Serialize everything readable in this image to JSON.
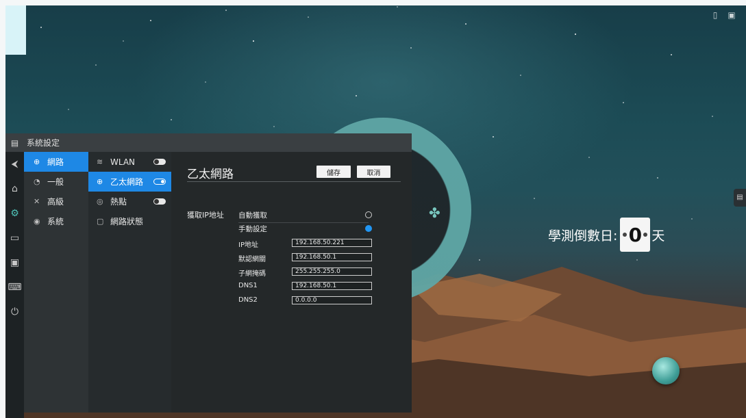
{
  "window": {
    "title": "系統設定"
  },
  "categories": [
    {
      "label": "網路",
      "icon": "globe-icon",
      "active": true
    },
    {
      "label": "一般",
      "icon": "palette-icon",
      "active": false
    },
    {
      "label": "高級",
      "icon": "tools-icon",
      "active": false
    },
    {
      "label": "系統",
      "icon": "system-icon",
      "active": false
    }
  ],
  "network_menu": [
    {
      "label": "WLAN",
      "icon": "wifi-icon",
      "toggle": "off"
    },
    {
      "label": "乙太網路",
      "icon": "ethernet-icon",
      "toggle": "on",
      "active": true
    },
    {
      "label": "熱點",
      "icon": "hotspot-icon",
      "toggle": "off"
    },
    {
      "label": "網路狀態",
      "icon": "network-status-icon"
    }
  ],
  "panel": {
    "title": "乙太網路",
    "save_label": "儲存",
    "cancel_label": "取消",
    "ip_section_label": "獲取IP地址",
    "modes": [
      {
        "label": "自動獲取",
        "selected": false
      },
      {
        "label": "手動設定",
        "selected": true
      }
    ],
    "fields": [
      {
        "label": "IP地址",
        "value": "192.168.50.221"
      },
      {
        "label": "默認網關",
        "value": "192.168.50.1"
      },
      {
        "label": "子網掩碼",
        "value": "255.255.255.0"
      },
      {
        "label": "DNS1",
        "value": "192.168.50.1"
      },
      {
        "label": "DNS2",
        "value": "0.0.0.0"
      }
    ]
  },
  "countdown": {
    "label": "學測倒數日:",
    "digit": "0",
    "unit": "天"
  },
  "dock": [
    "back-icon",
    "home-icon",
    "settings-icon",
    "folder-icon",
    "screen-icon",
    "keyboard-icon",
    "power-icon"
  ],
  "colors": {
    "accent": "#1e88e5",
    "teal": "#5fa6a5"
  }
}
